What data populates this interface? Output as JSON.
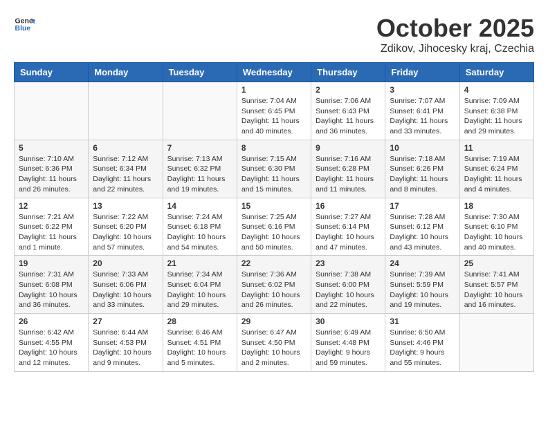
{
  "header": {
    "logo_general": "General",
    "logo_blue": "Blue",
    "month": "October 2025",
    "location": "Zdikov, Jihocesky kraj, Czechia"
  },
  "weekdays": [
    "Sunday",
    "Monday",
    "Tuesday",
    "Wednesday",
    "Thursday",
    "Friday",
    "Saturday"
  ],
  "weeks": [
    [
      {
        "day": "",
        "sunrise": "",
        "sunset": "",
        "daylight": ""
      },
      {
        "day": "",
        "sunrise": "",
        "sunset": "",
        "daylight": ""
      },
      {
        "day": "",
        "sunrise": "",
        "sunset": "",
        "daylight": ""
      },
      {
        "day": "1",
        "sunrise": "Sunrise: 7:04 AM",
        "sunset": "Sunset: 6:45 PM",
        "daylight": "Daylight: 11 hours and 40 minutes."
      },
      {
        "day": "2",
        "sunrise": "Sunrise: 7:06 AM",
        "sunset": "Sunset: 6:43 PM",
        "daylight": "Daylight: 11 hours and 36 minutes."
      },
      {
        "day": "3",
        "sunrise": "Sunrise: 7:07 AM",
        "sunset": "Sunset: 6:41 PM",
        "daylight": "Daylight: 11 hours and 33 minutes."
      },
      {
        "day": "4",
        "sunrise": "Sunrise: 7:09 AM",
        "sunset": "Sunset: 6:38 PM",
        "daylight": "Daylight: 11 hours and 29 minutes."
      }
    ],
    [
      {
        "day": "5",
        "sunrise": "Sunrise: 7:10 AM",
        "sunset": "Sunset: 6:36 PM",
        "daylight": "Daylight: 11 hours and 26 minutes."
      },
      {
        "day": "6",
        "sunrise": "Sunrise: 7:12 AM",
        "sunset": "Sunset: 6:34 PM",
        "daylight": "Daylight: 11 hours and 22 minutes."
      },
      {
        "day": "7",
        "sunrise": "Sunrise: 7:13 AM",
        "sunset": "Sunset: 6:32 PM",
        "daylight": "Daylight: 11 hours and 19 minutes."
      },
      {
        "day": "8",
        "sunrise": "Sunrise: 7:15 AM",
        "sunset": "Sunset: 6:30 PM",
        "daylight": "Daylight: 11 hours and 15 minutes."
      },
      {
        "day": "9",
        "sunrise": "Sunrise: 7:16 AM",
        "sunset": "Sunset: 6:28 PM",
        "daylight": "Daylight: 11 hours and 11 minutes."
      },
      {
        "day": "10",
        "sunrise": "Sunrise: 7:18 AM",
        "sunset": "Sunset: 6:26 PM",
        "daylight": "Daylight: 11 hours and 8 minutes."
      },
      {
        "day": "11",
        "sunrise": "Sunrise: 7:19 AM",
        "sunset": "Sunset: 6:24 PM",
        "daylight": "Daylight: 11 hours and 4 minutes."
      }
    ],
    [
      {
        "day": "12",
        "sunrise": "Sunrise: 7:21 AM",
        "sunset": "Sunset: 6:22 PM",
        "daylight": "Daylight: 11 hours and 1 minute."
      },
      {
        "day": "13",
        "sunrise": "Sunrise: 7:22 AM",
        "sunset": "Sunset: 6:20 PM",
        "daylight": "Daylight: 10 hours and 57 minutes."
      },
      {
        "day": "14",
        "sunrise": "Sunrise: 7:24 AM",
        "sunset": "Sunset: 6:18 PM",
        "daylight": "Daylight: 10 hours and 54 minutes."
      },
      {
        "day": "15",
        "sunrise": "Sunrise: 7:25 AM",
        "sunset": "Sunset: 6:16 PM",
        "daylight": "Daylight: 10 hours and 50 minutes."
      },
      {
        "day": "16",
        "sunrise": "Sunrise: 7:27 AM",
        "sunset": "Sunset: 6:14 PM",
        "daylight": "Daylight: 10 hours and 47 minutes."
      },
      {
        "day": "17",
        "sunrise": "Sunrise: 7:28 AM",
        "sunset": "Sunset: 6:12 PM",
        "daylight": "Daylight: 10 hours and 43 minutes."
      },
      {
        "day": "18",
        "sunrise": "Sunrise: 7:30 AM",
        "sunset": "Sunset: 6:10 PM",
        "daylight": "Daylight: 10 hours and 40 minutes."
      }
    ],
    [
      {
        "day": "19",
        "sunrise": "Sunrise: 7:31 AM",
        "sunset": "Sunset: 6:08 PM",
        "daylight": "Daylight: 10 hours and 36 minutes."
      },
      {
        "day": "20",
        "sunrise": "Sunrise: 7:33 AM",
        "sunset": "Sunset: 6:06 PM",
        "daylight": "Daylight: 10 hours and 33 minutes."
      },
      {
        "day": "21",
        "sunrise": "Sunrise: 7:34 AM",
        "sunset": "Sunset: 6:04 PM",
        "daylight": "Daylight: 10 hours and 29 minutes."
      },
      {
        "day": "22",
        "sunrise": "Sunrise: 7:36 AM",
        "sunset": "Sunset: 6:02 PM",
        "daylight": "Daylight: 10 hours and 26 minutes."
      },
      {
        "day": "23",
        "sunrise": "Sunrise: 7:38 AM",
        "sunset": "Sunset: 6:00 PM",
        "daylight": "Daylight: 10 hours and 22 minutes."
      },
      {
        "day": "24",
        "sunrise": "Sunrise: 7:39 AM",
        "sunset": "Sunset: 5:59 PM",
        "daylight": "Daylight: 10 hours and 19 minutes."
      },
      {
        "day": "25",
        "sunrise": "Sunrise: 7:41 AM",
        "sunset": "Sunset: 5:57 PM",
        "daylight": "Daylight: 10 hours and 16 minutes."
      }
    ],
    [
      {
        "day": "26",
        "sunrise": "Sunrise: 6:42 AM",
        "sunset": "Sunset: 4:55 PM",
        "daylight": "Daylight: 10 hours and 12 minutes."
      },
      {
        "day": "27",
        "sunrise": "Sunrise: 6:44 AM",
        "sunset": "Sunset: 4:53 PM",
        "daylight": "Daylight: 10 hours and 9 minutes."
      },
      {
        "day": "28",
        "sunrise": "Sunrise: 6:46 AM",
        "sunset": "Sunset: 4:51 PM",
        "daylight": "Daylight: 10 hours and 5 minutes."
      },
      {
        "day": "29",
        "sunrise": "Sunrise: 6:47 AM",
        "sunset": "Sunset: 4:50 PM",
        "daylight": "Daylight: 10 hours and 2 minutes."
      },
      {
        "day": "30",
        "sunrise": "Sunrise: 6:49 AM",
        "sunset": "Sunset: 4:48 PM",
        "daylight": "Daylight: 9 hours and 59 minutes."
      },
      {
        "day": "31",
        "sunrise": "Sunrise: 6:50 AM",
        "sunset": "Sunset: 4:46 PM",
        "daylight": "Daylight: 9 hours and 55 minutes."
      },
      {
        "day": "",
        "sunrise": "",
        "sunset": "",
        "daylight": ""
      }
    ]
  ]
}
